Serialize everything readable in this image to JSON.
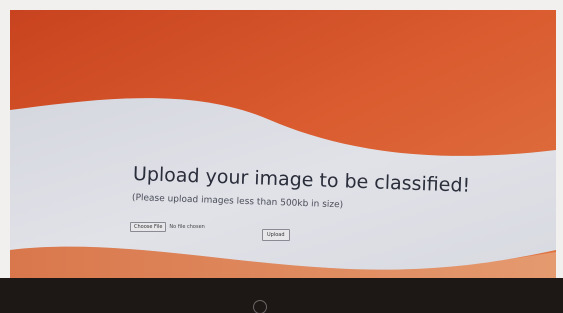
{
  "page": {
    "heading": "Upload your image to be classified!",
    "subheading": "(Please upload images less than 500kb in size)"
  },
  "upload_form": {
    "choose_file_label": "Choose File",
    "file_status": "No file chosen",
    "upload_label": "Upload"
  },
  "colors": {
    "background_orange": "#d9562c",
    "wave_white": "#dfe0e6",
    "bezel": "#f2f0ee",
    "laptop_base": "#1d1716"
  },
  "icons": {
    "brand_logo": "hp-logo-icon"
  }
}
